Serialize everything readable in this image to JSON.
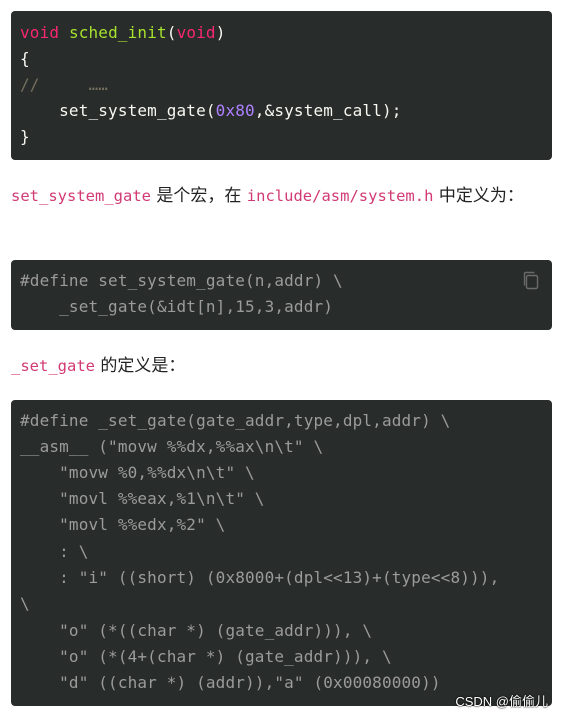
{
  "code_block_1": {
    "lines": [
      {
        "kw1": "void",
        "fn": "sched_init",
        "p1": "(",
        "kw2": "void",
        "p2": ")"
      },
      {
        "text": "{"
      },
      {
        "comment": "//     ……"
      },
      {
        "pre": "    set_system_gate(",
        "num": "0x80",
        "post": ",&system_call);"
      },
      {
        "text": "}"
      }
    ]
  },
  "paragraph_1": {
    "code_a": "set_system_gate",
    "text_a": " 是个宏，在 ",
    "code_b": "include/asm/system.h",
    "text_b": " 中定义为："
  },
  "code_block_2": {
    "lines": [
      "#define set_system_gate(n,addr) \\",
      "    _set_gate(&idt[n],15,3,addr)"
    ],
    "copy_icon": "copy-icon"
  },
  "paragraph_2": {
    "code_a": "_set_gate",
    "text_a": " 的定义是："
  },
  "code_block_3": {
    "lines": [
      "#define _set_gate(gate_addr,type,dpl,addr) \\",
      "__asm__ (\"movw %%dx,%%ax\\n\\t\" \\",
      "    \"movw %0,%%dx\\n\\t\" \\",
      "    \"movl %%eax,%1\\n\\t\" \\",
      "    \"movl %%edx,%2\" \\",
      "    : \\",
      "    : \"i\" ((short) (0x8000+(dpl<<13)+(type<<8))),",
      "\\",
      "    \"o\" (*((char *) (gate_addr))), \\",
      "    \"o\" (*(4+(char *) (gate_addr))), \\",
      "    \"d\" ((char *) (addr)),\"a\" (0x00080000))"
    ]
  },
  "watermark": "CSDN @偷偷儿"
}
